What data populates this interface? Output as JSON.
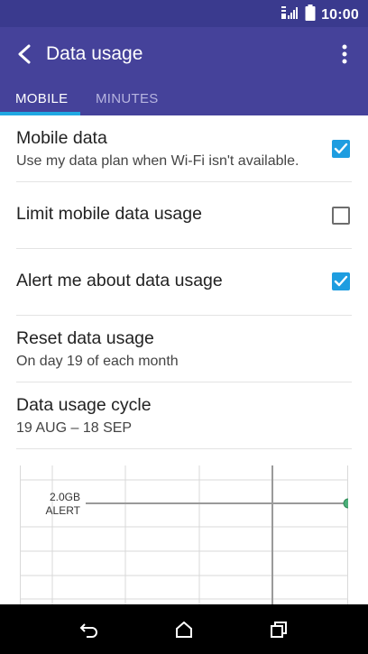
{
  "status_bar": {
    "time": "10:00"
  },
  "app_bar": {
    "title": "Data usage"
  },
  "tabs": [
    {
      "label": "MOBILE",
      "active": true
    },
    {
      "label": "MINUTES",
      "active": false
    }
  ],
  "settings": [
    {
      "title": "Mobile data",
      "subtitle": "Use my data plan when Wi-Fi isn't available.",
      "checked": true
    },
    {
      "title": "Limit mobile data usage",
      "checked": false
    },
    {
      "title": "Alert me about data usage",
      "checked": true
    },
    {
      "title": "Reset data usage",
      "subtitle": "On day 19 of each month"
    },
    {
      "title": "Data usage cycle",
      "subtitle": "19 AUG – 18 SEP"
    }
  ],
  "chart": {
    "alert_value": "2.0GB",
    "alert_label": "ALERT",
    "colors": {
      "alert_line": "#9a9a9a",
      "handle": "#4caf7a"
    }
  },
  "colors": {
    "status_bar": "#3a3a8e",
    "app_bar": "#45429a",
    "accent": "#1e9de0",
    "tab_indicator": "#20a8e2"
  }
}
